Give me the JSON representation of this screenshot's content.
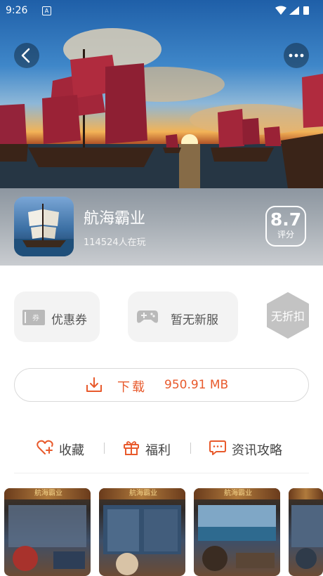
{
  "status_bar": {
    "time": "9:26",
    "notification_icon": "A"
  },
  "hero": {
    "back_icon": "chevron-left-icon",
    "more_icon": "more-dots-icon"
  },
  "game": {
    "name": "航海霸业",
    "players": "114524人在玩",
    "rating": "8.7",
    "rating_label": "评分"
  },
  "tags": {
    "coupon_label": "优惠券",
    "server_label": "暂无新服",
    "discount_label": "无折扣"
  },
  "download": {
    "label": "下载",
    "size": "950.91 MB"
  },
  "actions": {
    "favorite_label": "收藏",
    "gift_label": "福利",
    "guide_label": "资讯攻略"
  },
  "screenshots": {
    "logo_text": "航海霸业"
  },
  "colors": {
    "accent": "#e85a2c",
    "tag_bg": "#f3f3f3",
    "discount_bg": "#c3c3c3"
  }
}
